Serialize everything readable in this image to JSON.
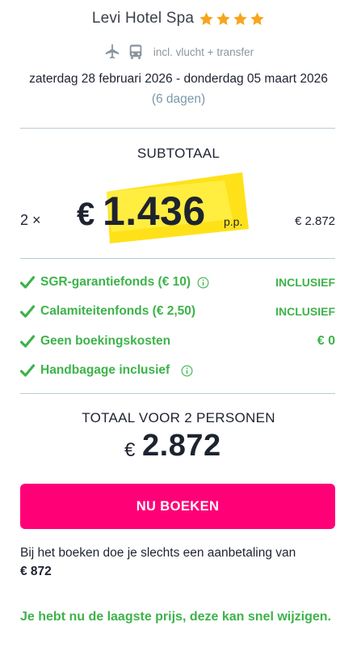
{
  "hotel": {
    "name": "Levi Hotel Spa",
    "stars": 4,
    "star_color": "#f8a51d",
    "includes": "incl. vlucht + transfer",
    "icons": [
      "plane-icon",
      "bus-icon"
    ]
  },
  "trip": {
    "dates": "zaterdag 28 februari 2026 - donderdag 05 maart 2026",
    "duration": "(6 dagen)"
  },
  "subtotal": {
    "title": "SUBTOTAAL",
    "multiplier": "2 ×",
    "currency": "€",
    "price_per_person": "1.436",
    "pp_label": "p.p.",
    "line_total": "€ 2.872",
    "highlight_color": "#ffe11a"
  },
  "fees": [
    {
      "label": "SGR-garantiefonds  (€ 10)",
      "value": "INCLUSIEF",
      "info": true
    },
    {
      "label": "Calamiteitenfonds  (€ 2,50)",
      "value": "INCLUSIEF",
      "info": false
    },
    {
      "label": "Geen boekingskosten",
      "value": "€ 0",
      "info": false
    },
    {
      "label": "Handbagage inclusief",
      "value": "",
      "info": true
    }
  ],
  "total": {
    "title": "TOTAAL VOOR 2 PERSONEN",
    "currency": "€",
    "value": "2.872"
  },
  "book_button": {
    "label": "NU BOEKEN",
    "color": "#ff0077"
  },
  "deposit": {
    "text": "Bij het boeken doe je slechts een aanbetaling van",
    "amount": "€ 872"
  },
  "notice": "Je hebt nu de laagste prijs, deze kan snel wijzigen.",
  "colors": {
    "accent_green": "#3db34a",
    "text_dark": "#1e2330",
    "muted_blue": "#7b98aa"
  }
}
